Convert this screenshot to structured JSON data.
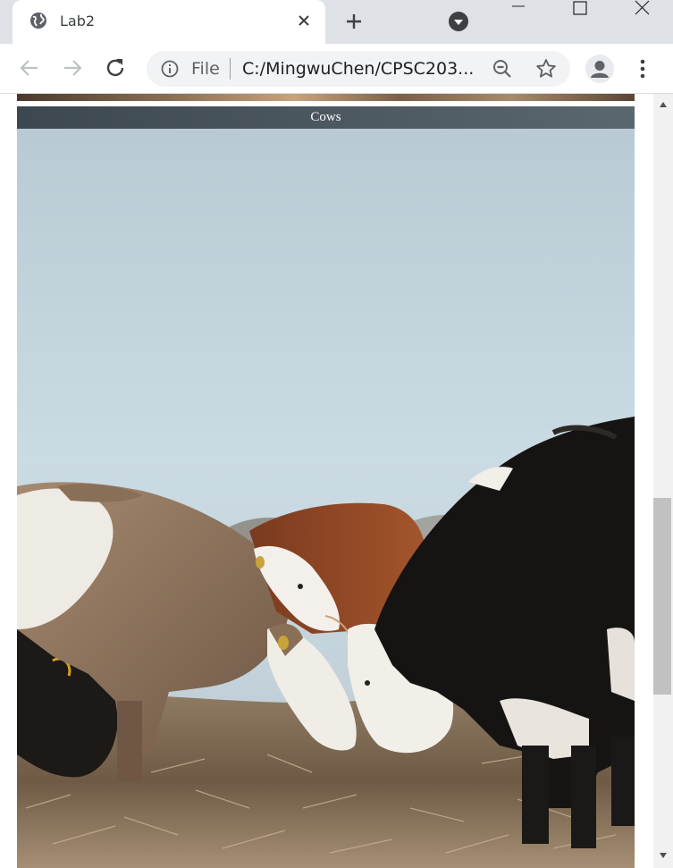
{
  "browser": {
    "tab_title": "Lab2",
    "omnibox": {
      "scheme_label": "File",
      "url": "C:/MingwuChen/CPSC203..."
    }
  },
  "page": {
    "caption": "Cows"
  },
  "scrollbar": {
    "position_fraction": 0.65
  },
  "colors": {
    "tab_strip": "#dee1e6",
    "caption_bar": "#4a555d",
    "sky": "#c6d6df"
  },
  "icons": [
    "globe-icon",
    "close-icon",
    "plus-icon",
    "tab-search-icon",
    "minimize-icon",
    "maximize-icon",
    "window-close-icon",
    "back-arrow-icon",
    "forward-arrow-icon",
    "reload-icon",
    "info-icon",
    "zoom-out-icon",
    "star-icon",
    "profile-icon",
    "kebab-menu-icon"
  ]
}
